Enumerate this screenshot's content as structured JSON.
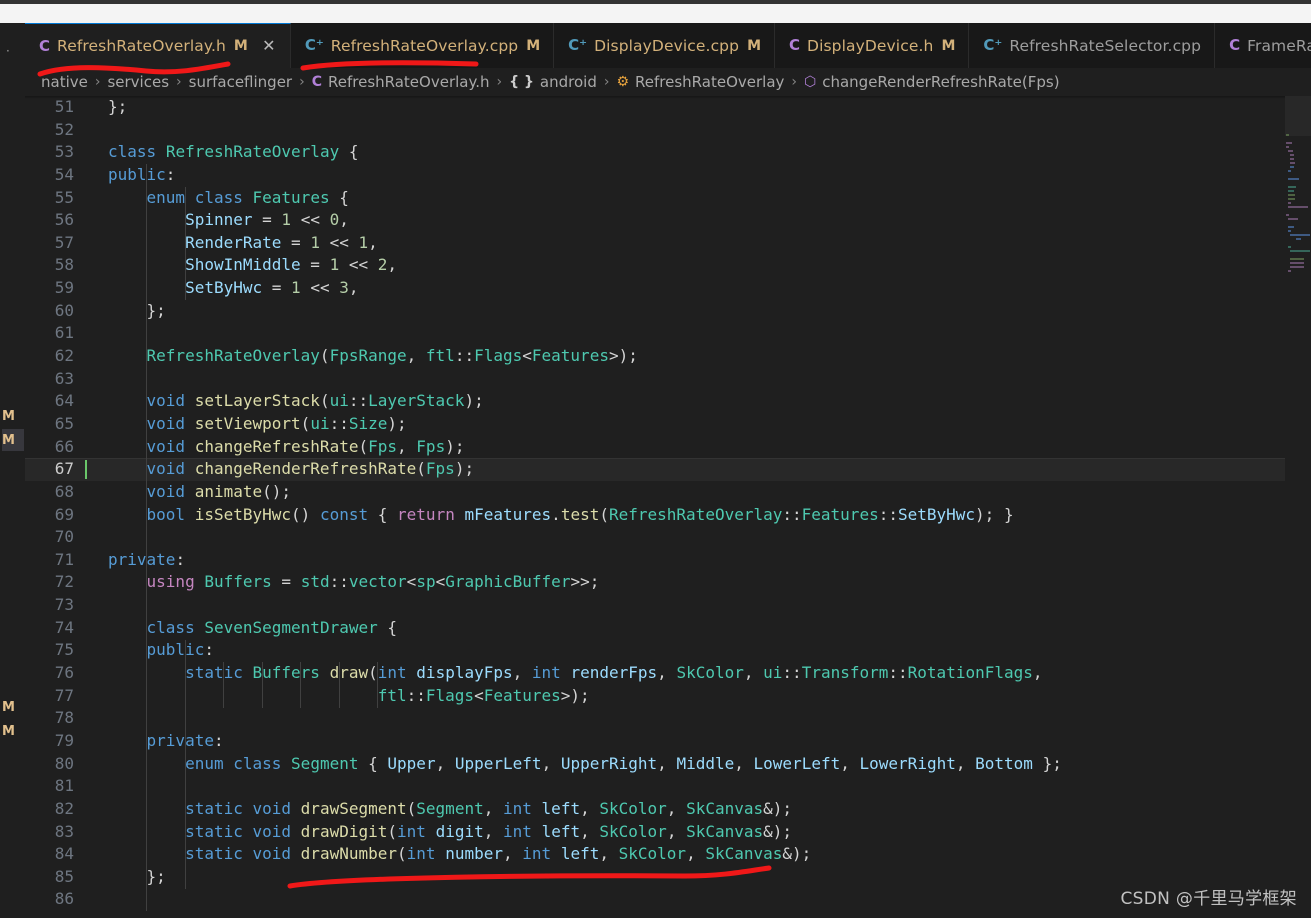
{
  "window": {
    "app": "Visual Studio Code",
    "theme_bg": "#1f1f1f",
    "accent": "#0078d4"
  },
  "tabs": [
    {
      "label": "RefreshRateOverlay.h",
      "icon": "c-header-icon",
      "icon_glyph": "C",
      "icon_kind": "h",
      "modified": "M",
      "active": true,
      "closable": true
    },
    {
      "label": "RefreshRateOverlay.cpp",
      "icon": "cpp-file-icon",
      "icon_glyph": "C⁺",
      "icon_kind": "cpp",
      "modified": "M",
      "active": false,
      "closable": false
    },
    {
      "label": "DisplayDevice.cpp",
      "icon": "cpp-file-icon",
      "icon_glyph": "C⁺",
      "icon_kind": "cpp",
      "modified": "M",
      "active": false,
      "closable": false
    },
    {
      "label": "DisplayDevice.h",
      "icon": "c-header-icon",
      "icon_glyph": "C",
      "icon_kind": "h",
      "modified": "M",
      "active": false,
      "closable": false
    },
    {
      "label": "RefreshRateSelector.cpp",
      "icon": "cpp-file-icon",
      "icon_glyph": "C⁺",
      "icon_kind": "cpp",
      "modified": "",
      "active": false,
      "closable": false
    },
    {
      "label": "FrameRat",
      "icon": "c-header-icon",
      "icon_glyph": "C",
      "icon_kind": "h",
      "modified": "",
      "active": false,
      "closable": false
    }
  ],
  "breadcrumb": [
    {
      "label": "native",
      "icon": ""
    },
    {
      "label": "services",
      "icon": ""
    },
    {
      "label": "surfaceflinger",
      "icon": ""
    },
    {
      "label": "RefreshRateOverlay.h",
      "icon": "C",
      "icon_kind": "cls"
    },
    {
      "label": "android",
      "icon": "{ }",
      "icon_kind": "ns"
    },
    {
      "label": "RefreshRateOverlay",
      "icon": "⚙",
      "icon_kind": "struct"
    },
    {
      "label": "changeRenderRefreshRate(Fps)",
      "icon": "⬡",
      "icon_kind": "method"
    }
  ],
  "editor": {
    "current_line": 67,
    "first_line": 51,
    "last_line": 86,
    "sidebar_modified_markers": [
      "M",
      "M",
      "M",
      "M"
    ],
    "lines": [
      {
        "n": 51,
        "text": "};"
      },
      {
        "n": 52,
        "text": ""
      },
      {
        "n": 53,
        "text": "class RefreshRateOverlay {"
      },
      {
        "n": 54,
        "text": "public:"
      },
      {
        "n": 55,
        "text": "    enum class Features {"
      },
      {
        "n": 56,
        "text": "        Spinner = 1 << 0,"
      },
      {
        "n": 57,
        "text": "        RenderRate = 1 << 1,"
      },
      {
        "n": 58,
        "text": "        ShowInMiddle = 1 << 2,"
      },
      {
        "n": 59,
        "text": "        SetByHwc = 1 << 3,"
      },
      {
        "n": 60,
        "text": "    };"
      },
      {
        "n": 61,
        "text": ""
      },
      {
        "n": 62,
        "text": "    RefreshRateOverlay(FpsRange, ftl::Flags<Features>);"
      },
      {
        "n": 63,
        "text": ""
      },
      {
        "n": 64,
        "text": "    void setLayerStack(ui::LayerStack);"
      },
      {
        "n": 65,
        "text": "    void setViewport(ui::Size);"
      },
      {
        "n": 66,
        "text": "    void changeRefreshRate(Fps, Fps);"
      },
      {
        "n": 67,
        "text": "    void changeRenderRefreshRate(Fps);"
      },
      {
        "n": 68,
        "text": "    void animate();"
      },
      {
        "n": 69,
        "text": "    bool isSetByHwc() const { return mFeatures.test(RefreshRateOverlay::Features::SetByHwc); }"
      },
      {
        "n": 70,
        "text": ""
      },
      {
        "n": 71,
        "text": "private:"
      },
      {
        "n": 72,
        "text": "    using Buffers = std::vector<sp<GraphicBuffer>>;"
      },
      {
        "n": 73,
        "text": ""
      },
      {
        "n": 74,
        "text": "    class SevenSegmentDrawer {"
      },
      {
        "n": 75,
        "text": "    public:"
      },
      {
        "n": 76,
        "text": "        static Buffers draw(int displayFps, int renderFps, SkColor, ui::Transform::RotationFlags,"
      },
      {
        "n": 77,
        "text": "                            ftl::Flags<Features>);"
      },
      {
        "n": 78,
        "text": ""
      },
      {
        "n": 79,
        "text": "    private:"
      },
      {
        "n": 80,
        "text": "        enum class Segment { Upper, UpperLeft, UpperRight, Middle, LowerLeft, LowerRight, Bottom };"
      },
      {
        "n": 81,
        "text": ""
      },
      {
        "n": 82,
        "text": "        static void drawSegment(Segment, int left, SkColor, SkCanvas&);"
      },
      {
        "n": 83,
        "text": "        static void drawDigit(int digit, int left, SkColor, SkCanvas&);"
      },
      {
        "n": 84,
        "text": "        static void drawNumber(int number, int left, SkColor, SkCanvas&);"
      },
      {
        "n": 85,
        "text": "    };"
      },
      {
        "n": 86,
        "text": ""
      }
    ]
  },
  "annotations": [
    {
      "name": "underline-active-tab",
      "color": "#f01818"
    },
    {
      "name": "underline-second-tab",
      "color": "#f01818"
    },
    {
      "name": "underline-drawnumber",
      "color": "#f01818"
    }
  ],
  "watermark": {
    "text": "CSDN @千里马学框架"
  }
}
